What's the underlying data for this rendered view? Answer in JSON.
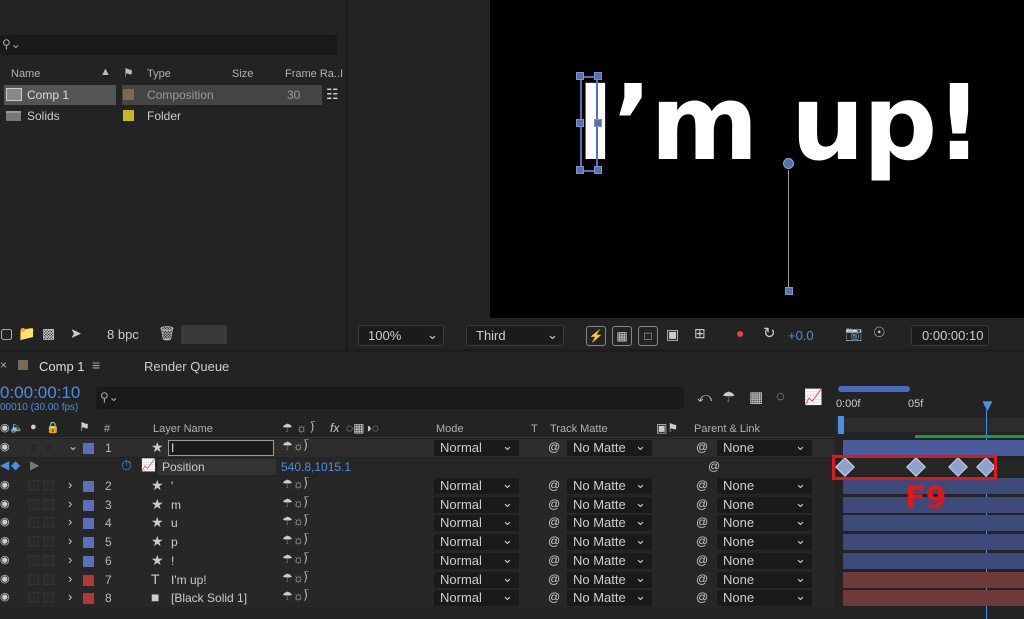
{
  "project": {
    "columns": [
      "Name",
      "Type",
      "Size",
      "Frame Ra...",
      "I"
    ],
    "items": [
      {
        "name": "Comp 1",
        "type": "Composition",
        "size": "",
        "frame_rate": "30",
        "color": "#7a6a55"
      },
      {
        "name": "Solids",
        "type": "Folder",
        "size": "",
        "frame_rate": "",
        "color": "#c8b820"
      }
    ],
    "bpc": "8 bpc"
  },
  "viewer": {
    "text": "I’m up!",
    "zoom": "100%",
    "resolution": "Third",
    "exposure": "+0.0",
    "timecode": "0:00:00:10"
  },
  "timeline": {
    "tab_comp": "Comp 1",
    "tab_render": "Render Queue",
    "timecode": "0:00:00:10",
    "fps_info": "00010 (30.00 fps)",
    "ruler": [
      "0:00f",
      "05f"
    ],
    "headers": {
      "number": "#",
      "layer_name": "Layer Name",
      "mode": "Mode",
      "t": "T",
      "track_matte": "Track Matte",
      "parent": "Parent & Link",
      "fx": "fx"
    },
    "position_label": "Position",
    "position_value": "540.8,1015.1",
    "annotation": "F9",
    "layers": [
      {
        "num": "1",
        "icon": "★",
        "name": "I",
        "mode": "Normal",
        "matte": "",
        "parent": "None",
        "color": "#5d6fb8"
      },
      {
        "num": "2",
        "icon": "★",
        "name": "'",
        "mode": "Normal",
        "matte": "No Matte",
        "parent": "None",
        "color": "#5d6fb8"
      },
      {
        "num": "3",
        "icon": "★",
        "name": "m",
        "mode": "Normal",
        "matte": "No Matte",
        "parent": "None",
        "color": "#5d6fb8"
      },
      {
        "num": "4",
        "icon": "★",
        "name": "u",
        "mode": "Normal",
        "matte": "No Matte",
        "parent": "None",
        "color": "#5d6fb8"
      },
      {
        "num": "5",
        "icon": "★",
        "name": "p",
        "mode": "Normal",
        "matte": "No Matte",
        "parent": "None",
        "color": "#5d6fb8"
      },
      {
        "num": "6",
        "icon": "★",
        "name": "!",
        "mode": "Normal",
        "matte": "No Matte",
        "parent": "None",
        "color": "#5d6fb8"
      },
      {
        "num": "7",
        "icon": "T",
        "name": "I'm up!",
        "mode": "Normal",
        "matte": "No Matte",
        "parent": "None",
        "color": "#b03a3a"
      },
      {
        "num": "8",
        "icon": "■",
        "name": "[Black Solid 1]",
        "mode": "Normal",
        "matte": "No Matte",
        "parent": "None",
        "color": "#b03a3a"
      }
    ],
    "layer1_matte": "No Matte"
  }
}
